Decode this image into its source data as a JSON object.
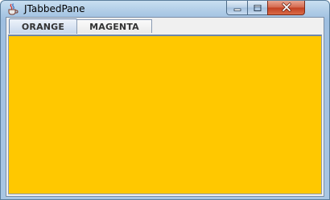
{
  "window": {
    "title": "JTabbedPane",
    "icon": "java-coffee-icon"
  },
  "controls": {
    "minimize_icon": "minimize-icon",
    "maximize_icon": "maximize-icon",
    "close_icon": "close-icon"
  },
  "tabs": [
    {
      "label": "ORANGE",
      "selected": true
    },
    {
      "label": "MAGENTA",
      "selected": false
    }
  ],
  "panel": {
    "color": "#ffc800"
  },
  "colors": {
    "panel_orange": "#ffc800",
    "close_red": "#c94a2e",
    "titlebar_blue": "#b5d0ea"
  }
}
